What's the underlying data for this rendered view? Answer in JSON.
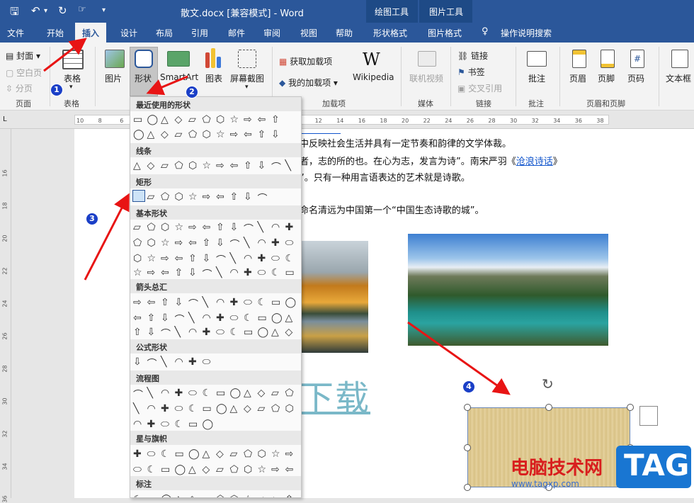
{
  "window": {
    "title": "散文.docx [兼容模式]  -  Word"
  },
  "context_tabs": {
    "drawing_tools": "绘图工具",
    "picture_tools": "图片工具"
  },
  "tabs": [
    "文件",
    "开始",
    "插入",
    "设计",
    "布局",
    "引用",
    "邮件",
    "审阅",
    "视图",
    "帮助",
    "形状格式",
    "图片格式",
    "操作说明搜索"
  ],
  "active_tab": "插入",
  "ribbon": {
    "page_group": {
      "label": "页面",
      "cover": "封面",
      "blank": "空白页",
      "break": "分页"
    },
    "table_group": {
      "label": "表格",
      "table": "表格"
    },
    "illus": {
      "picture": "图片",
      "shapes": "形状",
      "smartart": "SmartArt",
      "chart": "图表",
      "screenshot": "屏幕截图"
    },
    "addins": {
      "label": "加载项",
      "get": "获取加载项",
      "my": "我的加载项",
      "wiki": "Wikipedia"
    },
    "media": {
      "label": "媒体",
      "online_video": "联机视频"
    },
    "links": {
      "label": "链接",
      "link": "链接",
      "bookmark": "书签",
      "cross_ref": "交叉引用"
    },
    "comments": {
      "label": "批注",
      "comment": "批注"
    },
    "header_footer": {
      "label": "页眉和页脚",
      "header": "页眉",
      "footer": "页脚",
      "page_num": "页码"
    },
    "text": {
      "textbox": "文本框"
    }
  },
  "ruler_numbers": [
    "10",
    "8",
    "6",
    "4",
    "2",
    "",
    "2",
    "4",
    "6",
    "8",
    "10",
    "12",
    "14",
    "16",
    "18",
    "20",
    "22",
    "24",
    "26",
    "28",
    "30",
    "32",
    "34",
    "36",
    "38"
  ],
  "left_ruler_numbers": [
    "16",
    "18",
    "20",
    "22",
    "24",
    "26",
    "28",
    "30",
    "32",
    "34",
    "36"
  ],
  "document": {
    "line1": "中反映社会生活并具有一定节奏和韵律的文学体裁。",
    "line2a": "者，志的所的也。在心为志，发言为诗”。南宋严羽《",
    "line2_link": "沧浪诗话",
    "line2b": "》",
    "line3": "”。只有一种用言语表达的艺术就是诗歌。",
    "line4": "命名清远为中国第一个“中国生态诗歌的城”。",
    "big_text": "下载"
  },
  "dropdown": {
    "categories": [
      "最近使用的形状",
      "线条",
      "矩形",
      "基本形状",
      "箭头总汇",
      "公式形状",
      "流程图",
      "星与旗帜",
      "标注"
    ]
  },
  "callouts": [
    "1",
    "2",
    "3",
    "4"
  ],
  "watermark": {
    "site_cn": "电脑技术网",
    "url": "www.tagxp.com",
    "tag": "TAG"
  },
  "colors": {
    "word_blue": "#2b579a",
    "callout_blue": "#1a3fc7",
    "arrow_red": "#e81414"
  }
}
